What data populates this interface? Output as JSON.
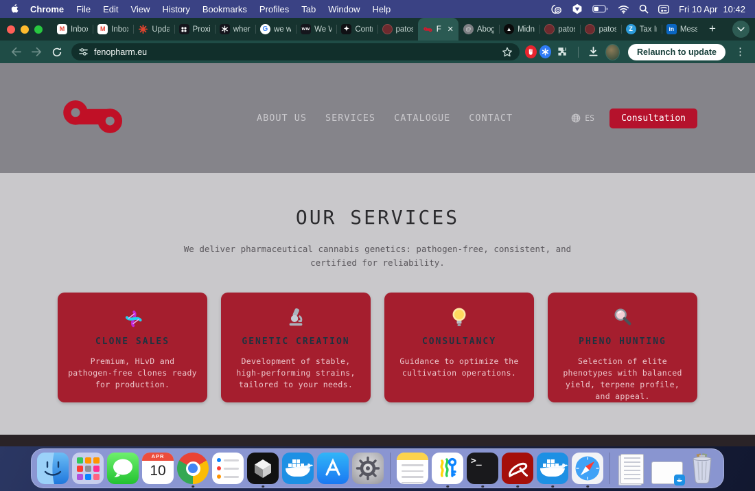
{
  "menubar": {
    "app_name": "Chrome",
    "menus": [
      "File",
      "Edit",
      "View",
      "History",
      "Bookmarks",
      "Profiles",
      "Tab",
      "Window",
      "Help"
    ],
    "status_icons": [
      "app-badge-icon",
      "shield-hexagon-icon",
      "battery-icon",
      "wifi-icon",
      "search-icon",
      "control-center-icon"
    ],
    "status_date": "Fri 10 Apr",
    "status_time": "10:42"
  },
  "tabstrip": {
    "tabs": [
      {
        "title": "Inbox",
        "icon": "gmail-icon"
      },
      {
        "title": "Inbox",
        "icon": "gmail-icon"
      },
      {
        "title": "Upda",
        "icon": "starburst-icon"
      },
      {
        "title": "Proxi",
        "icon": "dots-grid-icon"
      },
      {
        "title": "wher",
        "icon": "knot-dark-icon"
      },
      {
        "title": "we w",
        "icon": "google-g-icon"
      },
      {
        "title": "We W",
        "icon": "dark-w-icon"
      },
      {
        "title": "Contr",
        "icon": "diamond-plus-icon"
      },
      {
        "title": "patos",
        "icon": "avatar-red-icon"
      },
      {
        "title": "F",
        "icon": "fenopharm-favicon",
        "active": true,
        "close": "✕"
      },
      {
        "title": "Abog",
        "icon": "avatar-gray-icon"
      },
      {
        "title": "Midni",
        "icon": "midnight-icon"
      },
      {
        "title": "patos",
        "icon": "avatar-red-icon"
      },
      {
        "title": "patos",
        "icon": "avatar-red-icon"
      },
      {
        "title": "Tax In",
        "icon": "tax-blue-icon"
      },
      {
        "title": "Mess",
        "icon": "linkedin-icon"
      }
    ],
    "new_tab_label": "+"
  },
  "toolbar": {
    "url": "fenopharm.eu",
    "relaunch_label": "Relaunch to update"
  },
  "site": {
    "nav": [
      "ABOUT US",
      "SERVICES",
      "CATALOGUE",
      "CONTACT"
    ],
    "lang_label": "ES",
    "cta_label": "Consultation",
    "heading": "OUR SERVICES",
    "subtitle": "We deliver pharmaceutical cannabis genetics: pathogen-free, consistent, and certified for reliability.",
    "cards": [
      {
        "title": "CLONE SALES",
        "icon": "dna-icon",
        "desc": "Premium, HLvD and pathogen-free clones ready for production."
      },
      {
        "title": "GENETIC CREATION",
        "icon": "microscope-icon",
        "desc": "Development of stable, high-performing strains, tailored to your needs."
      },
      {
        "title": "CONSULTANCY",
        "icon": "lightbulb-icon",
        "desc": "Guidance to optimize the cultivation operations."
      },
      {
        "title": "PHENO HUNTING",
        "icon": "magnifier-icon",
        "desc": "Selection of elite phenotypes with balanced yield, terpene profile, and appeal."
      }
    ]
  },
  "dock": {
    "items": [
      {
        "name": "finder",
        "running": true
      },
      {
        "name": "launchpad",
        "running": false
      },
      {
        "name": "messages",
        "running": false
      },
      {
        "name": "calendar",
        "running": false,
        "month": "APR",
        "day": "10"
      },
      {
        "name": "chrome",
        "running": true
      },
      {
        "name": "reminders",
        "running": false
      },
      {
        "name": "cube-3d-app",
        "running": true
      },
      {
        "name": "docker",
        "running": false
      },
      {
        "name": "app-store",
        "running": false
      },
      {
        "name": "system-settings",
        "running": false
      },
      {
        "name": "notes",
        "running": true
      },
      {
        "name": "passwords",
        "running": true
      },
      {
        "name": "terminal",
        "running": true,
        "prompt": ">_"
      },
      {
        "name": "acrobat",
        "running": true
      },
      {
        "name": "docker",
        "running": true
      },
      {
        "name": "safari",
        "running": true
      },
      {
        "name": "document-stack",
        "running": false
      },
      {
        "name": "window-thumbnail",
        "running": false
      },
      {
        "name": "trash",
        "running": false
      }
    ]
  },
  "colors": {
    "accent_red": "#b5122c",
    "card_red": "#a51e2e",
    "logo_red": "#c01026",
    "menubar_navy": "#3a4284",
    "tabstrip_teal": "#16332f",
    "toolbar_teal": "#1f4c46",
    "header_gray": "#85848a",
    "page_gray": "#c9c8cb",
    "dock_periwinkle": "#949fdd"
  }
}
